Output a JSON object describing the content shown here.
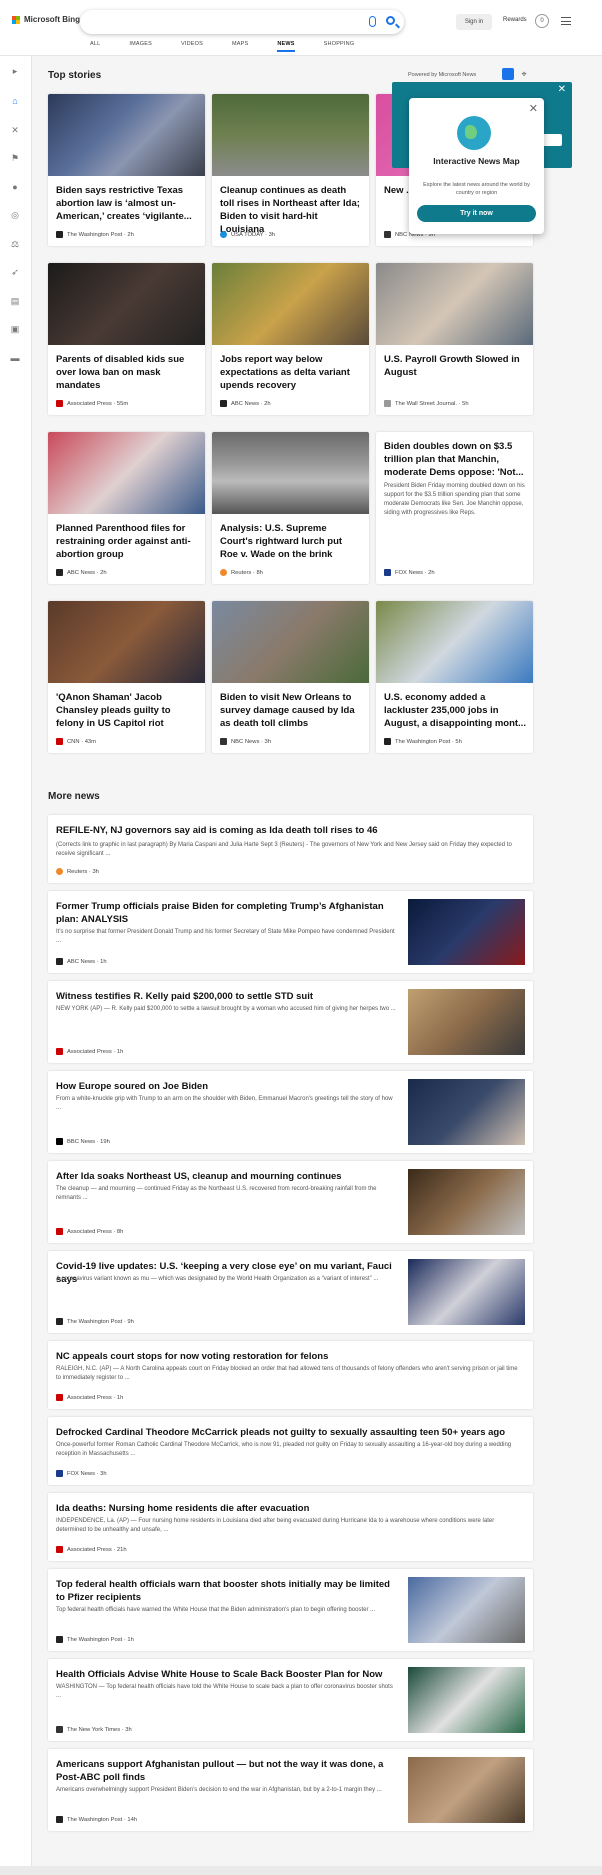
{
  "header": {
    "logo": "Microsoft Bing",
    "signin": "Sign in",
    "rewards": "Rewards",
    "rewards_count": "0"
  },
  "nav": [
    "ALL",
    "IMAGES",
    "VIDEOS",
    "MAPS",
    "NEWS",
    "SHOPPING"
  ],
  "top_stories": {
    "title": "Top stories",
    "powered": "Powered by Microsoft News"
  },
  "popup": {
    "title": "Interactive News Map",
    "desc": "Explore the latest news around the world by country or region",
    "button": "Try it now"
  },
  "cards": [
    {
      "title": "Biden says restrictive Texas abortion law is ‘almost un-American,’ creates ‘vigilante...",
      "source": "The Washington Post · 2h"
    },
    {
      "title": "Cleanup continues as death toll rises in Northeast after Ida; Biden to visit hard-hit Louisiana",
      "source": "USA TODAY · 3h"
    },
    {
      "title": "New ... after ... Texa...",
      "source": "NBC News · 9h"
    },
    {
      "title": "Parents of disabled kids sue over Iowa ban on mask mandates",
      "source": "Associated Press · 55m"
    },
    {
      "title": "Jobs report way below expectations as delta variant upends recovery",
      "source": "ABC News · 2h"
    },
    {
      "title": "U.S. Payroll Growth Slowed in August",
      "source": "The Wall Street Journal. · 5h"
    },
    {
      "title": "Planned Parenthood files for restraining order against anti-abortion group",
      "source": "ABC News · 2h"
    },
    {
      "title": "Analysis: U.S. Supreme Court's rightward lurch put Roe v. Wade on the brink",
      "source": "Reuters · 8h"
    },
    {
      "title": "Biden doubles down on $3.5 trillion plan that Manchin, moderate Dems oppose: 'Not...",
      "desc": "President Biden Friday morning doubled down on his support for the $3.5 trillion spending plan that some moderate Democrats like Sen. Joe Manchin oppose, siding with progressives like Reps.",
      "source": "FOX News · 2h"
    },
    {
      "title": "'QAnon Shaman' Jacob Chansley pleads guilty to felony in US Capitol riot",
      "source": "CNN · 43m"
    },
    {
      "title": "Biden to visit New Orleans to survey damage caused by Ida as death toll climbs",
      "source": "NBC News · 3h"
    },
    {
      "title": "U.S. economy added a lackluster 235,000 jobs in August, a disappointing mont...",
      "source": "The Washington Post · 5h"
    }
  ],
  "more_news": {
    "title": "More news",
    "items": [
      {
        "title": "REFILE-NY, NJ governors say aid is coming as Ida death toll rises to 46",
        "desc": "(Corrects link to graphic in last paragraph) By Maria Caspani and Julia Harte Sept 3 (Reuters) - The governors of New York and New Jersey said on Friday they expected to receive significant ...",
        "source": "Reuters · 3h"
      },
      {
        "title": "Former Trump officials praise Biden for completing Trump’s Afghanistan plan: ANALYSIS",
        "desc": "It's no surprise that former President Donald Trump and his former Secretary of State Mike Pompeo have condemned President ...",
        "source": "ABC News · 1h"
      },
      {
        "title": "Witness testifies R. Kelly paid $200,000 to settle STD suit",
        "desc": "NEW YORK (AP) — R. Kelly paid $200,000 to settle a lawsuit brought by a woman who accused him of giving her herpes two ...",
        "source": "Associated Press · 1h"
      },
      {
        "title": "How Europe soured on Joe Biden",
        "desc": "From a white-knuckle grip with Trump to an arm on the shoulder with Biden, Emmanuel Macron's greetings tell the story of how ...",
        "source": "BBC News · 19h"
      },
      {
        "title": "After Ida soaks Northeast US, cleanup and mourning continues",
        "desc": "The cleanup — and mourning — continued Friday as the Northeast U.S. recovered from record-breaking rainfall from the remnants ...",
        "source": "Associated Press · 8h"
      },
      {
        "title": "Covid-19 live updates: U.S. ‘keeping a very close eye’ on mu variant, Fauci says",
        "desc": "A coronavirus variant known as mu — which was designated by the World Health Organization as a “variant of interest” ...",
        "source": "The Washington Post · 9h"
      },
      {
        "title": "NC appeals court stops for now voting restoration for felons",
        "desc": "RALEIGH, N.C. (AP) — A North Carolina appeals court on Friday blocked an order that had allowed tens of thousands of felony offenders who aren't serving prison or jail time to immediately register to ...",
        "source": "Associated Press · 1h"
      },
      {
        "title": "Defrocked Cardinal Theodore McCarrick pleads not guilty to sexually assaulting teen 50+ years ago",
        "desc": "Once-powerful former Roman Catholic Cardinal Theodore McCarrick, who is now 91, pleaded not guilty on Friday to sexually assaulting a 16-year-old boy during a wedding reception in Massachusetts ...",
        "source": "FOX News · 3h"
      },
      {
        "title": "Ida deaths: Nursing home residents die after evacuation",
        "desc": "INDEPENDENCE, La. (AP) — Four nursing home residents in Louisiana died after being evacuated during Hurricane Ida to a warehouse where conditions were later determined to be unhealthy and unsafe, ...",
        "source": "Associated Press · 21h"
      },
      {
        "title": "Top federal health officials warn that booster shots initially may be limited to Pfizer recipients",
        "desc": "Top federal health officials have warned the White House that the Biden administration's plan to begin offering booster ...",
        "source": "The Washington Post · 1h"
      },
      {
        "title": "Health Officials Advise White House to Scale Back Booster Plan for Now",
        "desc": "WASHINGTON — Top federal health officials have told the White House to scale back a plan to offer coronavirus booster shots ...",
        "source": "The New York Times · 3h"
      },
      {
        "title": "Americans support Afghanistan pullout — but not the way it was done, a Post-ABC poll finds",
        "desc": "Americans overwhelmingly support President Biden’s decision to end the war in Afghanistan, but by a 2-to-1 margin they ...",
        "source": "The Washington Post · 14h"
      }
    ]
  }
}
